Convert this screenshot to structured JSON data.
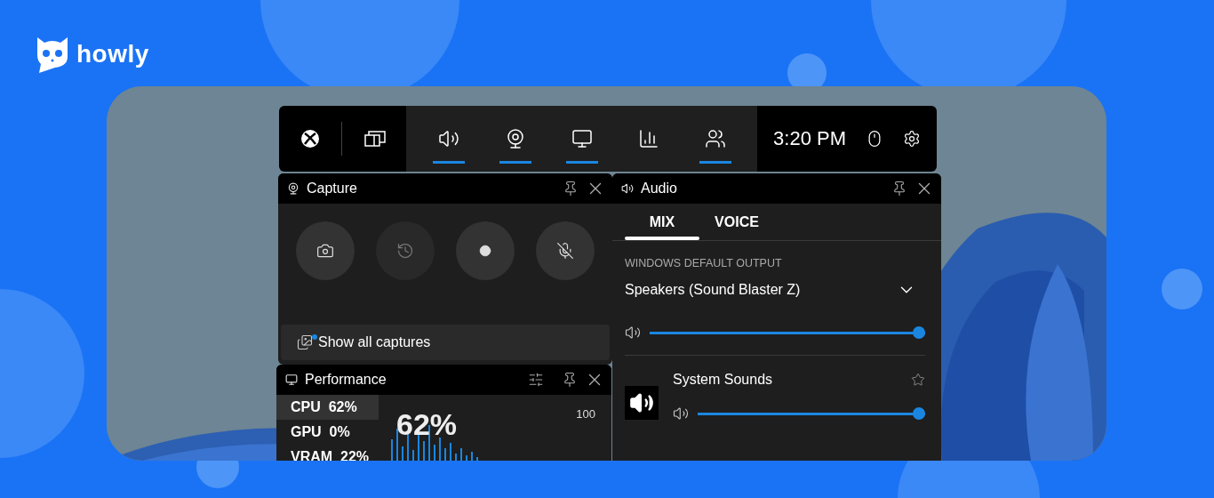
{
  "brand": {
    "name": "howly"
  },
  "toolbar": {
    "widgets": [
      {
        "kind": "audio",
        "selected": true
      },
      {
        "kind": "capture",
        "selected": true
      },
      {
        "kind": "performance",
        "selected": true
      },
      {
        "kind": "resources",
        "selected": false
      },
      {
        "kind": "social",
        "selected": true
      }
    ],
    "time": "3:20 PM"
  },
  "capture": {
    "title": "Capture",
    "buttons": [
      {
        "kind": "screenshot",
        "disabled": false
      },
      {
        "kind": "record-last",
        "disabled": true
      },
      {
        "kind": "record",
        "disabled": false
      },
      {
        "kind": "mic",
        "disabled": false
      }
    ],
    "gallery": {
      "label": "Show all captures",
      "new": true
    }
  },
  "audio": {
    "title": "Audio",
    "tabs": [
      {
        "label": "MIX",
        "selected": true
      },
      {
        "label": "VOICE",
        "selected": false
      }
    ],
    "section": "WINDOWS DEFAULT OUTPUT",
    "device": "Speakers (Sound Blaster Z)",
    "level": 1.0,
    "apps": [
      {
        "name": "System Sounds",
        "level": 1.0,
        "favorite": false
      }
    ]
  },
  "performance": {
    "title": "Performance",
    "metrics": [
      {
        "label": "CPU",
        "value": "62%",
        "selected": true
      },
      {
        "label": "GPU",
        "value": "0%",
        "selected": false
      },
      {
        "label": "VRAM",
        "value": "22%",
        "selected": false
      }
    ],
    "reading": "62%",
    "axis_max": "100"
  }
}
